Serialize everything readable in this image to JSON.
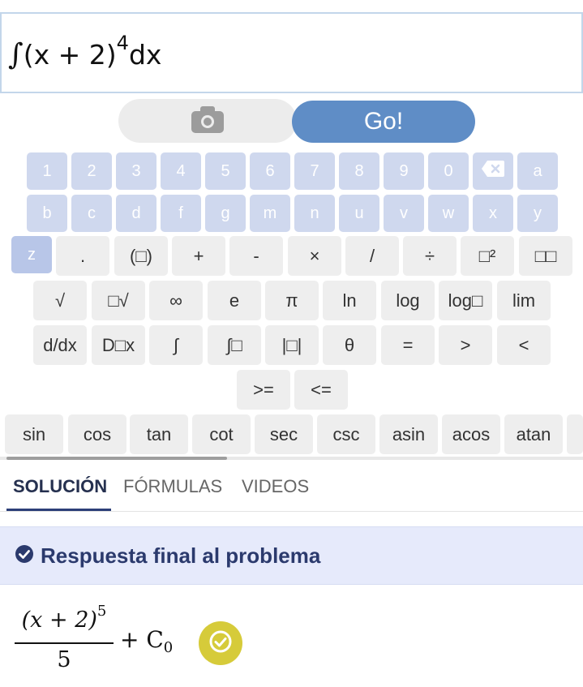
{
  "input": {
    "expression_prefix": "(x + 2)",
    "integral_symbol": "∫",
    "exponent": "4",
    "suffix": "dx"
  },
  "buttons": {
    "camera_icon": "camera-icon",
    "go_label": "Go!"
  },
  "keyboard": {
    "row1": [
      "1",
      "2",
      "3",
      "4",
      "5",
      "6",
      "7",
      "8",
      "9",
      "0",
      "a"
    ],
    "backspace_icon": "backspace-icon",
    "row2": [
      "b",
      "c",
      "d",
      "f",
      "g",
      "m",
      "n",
      "u",
      "v",
      "w",
      "x",
      "y"
    ],
    "row3": [
      "z",
      ".",
      "(□)",
      "+",
      "-",
      "×",
      "/",
      "÷",
      "□²",
      "□□"
    ],
    "row4": [
      "√",
      "□√",
      "∞",
      "e",
      "π",
      "ln",
      "log",
      "log□",
      "lim"
    ],
    "row5": [
      "d/dx",
      "D□x",
      "∫",
      "∫□",
      "|□|",
      "θ",
      "=",
      ">",
      "<"
    ],
    "row6": [
      ">=",
      "<="
    ],
    "row7": [
      "sin",
      "cos",
      "tan",
      "cot",
      "sec",
      "csc",
      "asin",
      "acos",
      "atan"
    ]
  },
  "tabs": [
    "SOLUCIÓN",
    "FÓRMULAS",
    "VIDEOS"
  ],
  "answer": {
    "banner_title": "Respuesta final al problema",
    "numerator": "(x + 2)",
    "numerator_exp": "5",
    "denominator": "5",
    "plus_term": "+ C",
    "subscript": "0"
  },
  "colors": {
    "accent": "#5f8dc6",
    "key_blue": "#cfd8ee",
    "banner_bg": "#e6eafb",
    "check_badge": "#d6cb3a"
  }
}
